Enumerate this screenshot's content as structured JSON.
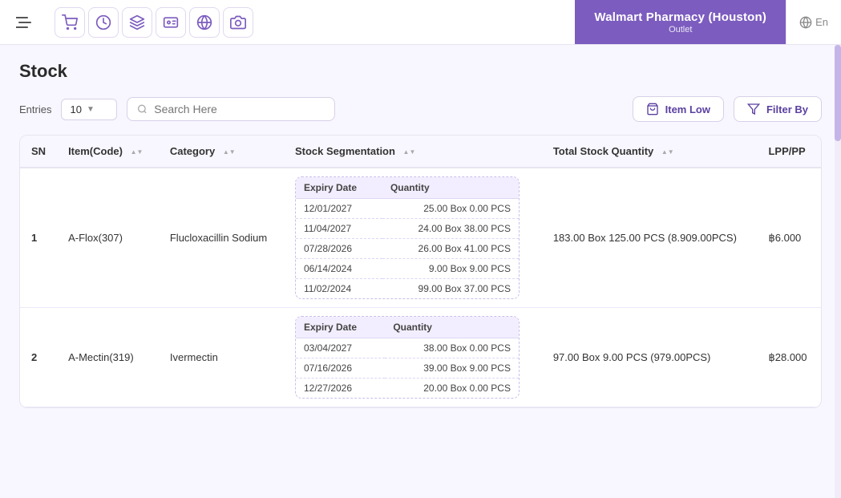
{
  "topnav": {
    "toggle_icon": "☰",
    "icons": [
      {
        "name": "cart-icon",
        "symbol": "🛒"
      },
      {
        "name": "clock-icon",
        "symbol": "⏱"
      },
      {
        "name": "layers-icon",
        "symbol": "🗂"
      },
      {
        "name": "id-card-icon",
        "symbol": "🪪"
      },
      {
        "name": "globe-icon",
        "symbol": "🌐"
      },
      {
        "name": "camera-icon",
        "symbol": "📷"
      }
    ],
    "brand": {
      "name": "Walmart Pharmacy (Houston)",
      "sub": "Outlet"
    },
    "lang": "En"
  },
  "page": {
    "title": "Stock"
  },
  "toolbar": {
    "entries_label": "Entries",
    "entries_value": "10",
    "search_placeholder": "Search Here",
    "item_low_label": "Item Low",
    "filter_label": "Filter By"
  },
  "table": {
    "headers": [
      {
        "key": "sn",
        "label": "SN",
        "sortable": false
      },
      {
        "key": "item_code",
        "label": "Item(Code)",
        "sortable": true
      },
      {
        "key": "category",
        "label": "Category",
        "sortable": true
      },
      {
        "key": "stock_seg",
        "label": "Stock Segmentation",
        "sortable": true
      },
      {
        "key": "total_stock",
        "label": "Total Stock Quantity",
        "sortable": true
      },
      {
        "key": "lpp",
        "label": "LPP/PP",
        "sortable": false
      }
    ],
    "rows": [
      {
        "sn": "1",
        "item_code": "A-Flox(307)",
        "category": "Flucloxacillin Sodium",
        "stock_seg": [
          {
            "expiry": "12/01/2027",
            "quantity": "25.00 Box 0.00 PCS"
          },
          {
            "expiry": "11/04/2027",
            "quantity": "24.00 Box 38.00 PCS"
          },
          {
            "expiry": "07/28/2026",
            "quantity": "26.00 Box 41.00 PCS"
          },
          {
            "expiry": "06/14/2024",
            "quantity": "9.00 Box 9.00 PCS"
          },
          {
            "expiry": "11/02/2024",
            "quantity": "99.00 Box 37.00 PCS"
          }
        ],
        "total_stock": "183.00 Box 125.00 PCS (8.909.00PCS)",
        "lpp": "฿6.000"
      },
      {
        "sn": "2",
        "item_code": "A-Mectin(319)",
        "category": "Ivermectin",
        "stock_seg": [
          {
            "expiry": "03/04/2027",
            "quantity": "38.00 Box 0.00 PCS"
          },
          {
            "expiry": "07/16/2026",
            "quantity": "39.00 Box 9.00 PCS"
          },
          {
            "expiry": "12/27/2026",
            "quantity": "20.00 Box 0.00 PCS"
          }
        ],
        "total_stock": "97.00 Box 9.00 PCS (979.00PCS)",
        "lpp": "฿28.000"
      }
    ],
    "seg_col_expiry": "Expiry Date",
    "seg_col_qty": "Quantity"
  }
}
